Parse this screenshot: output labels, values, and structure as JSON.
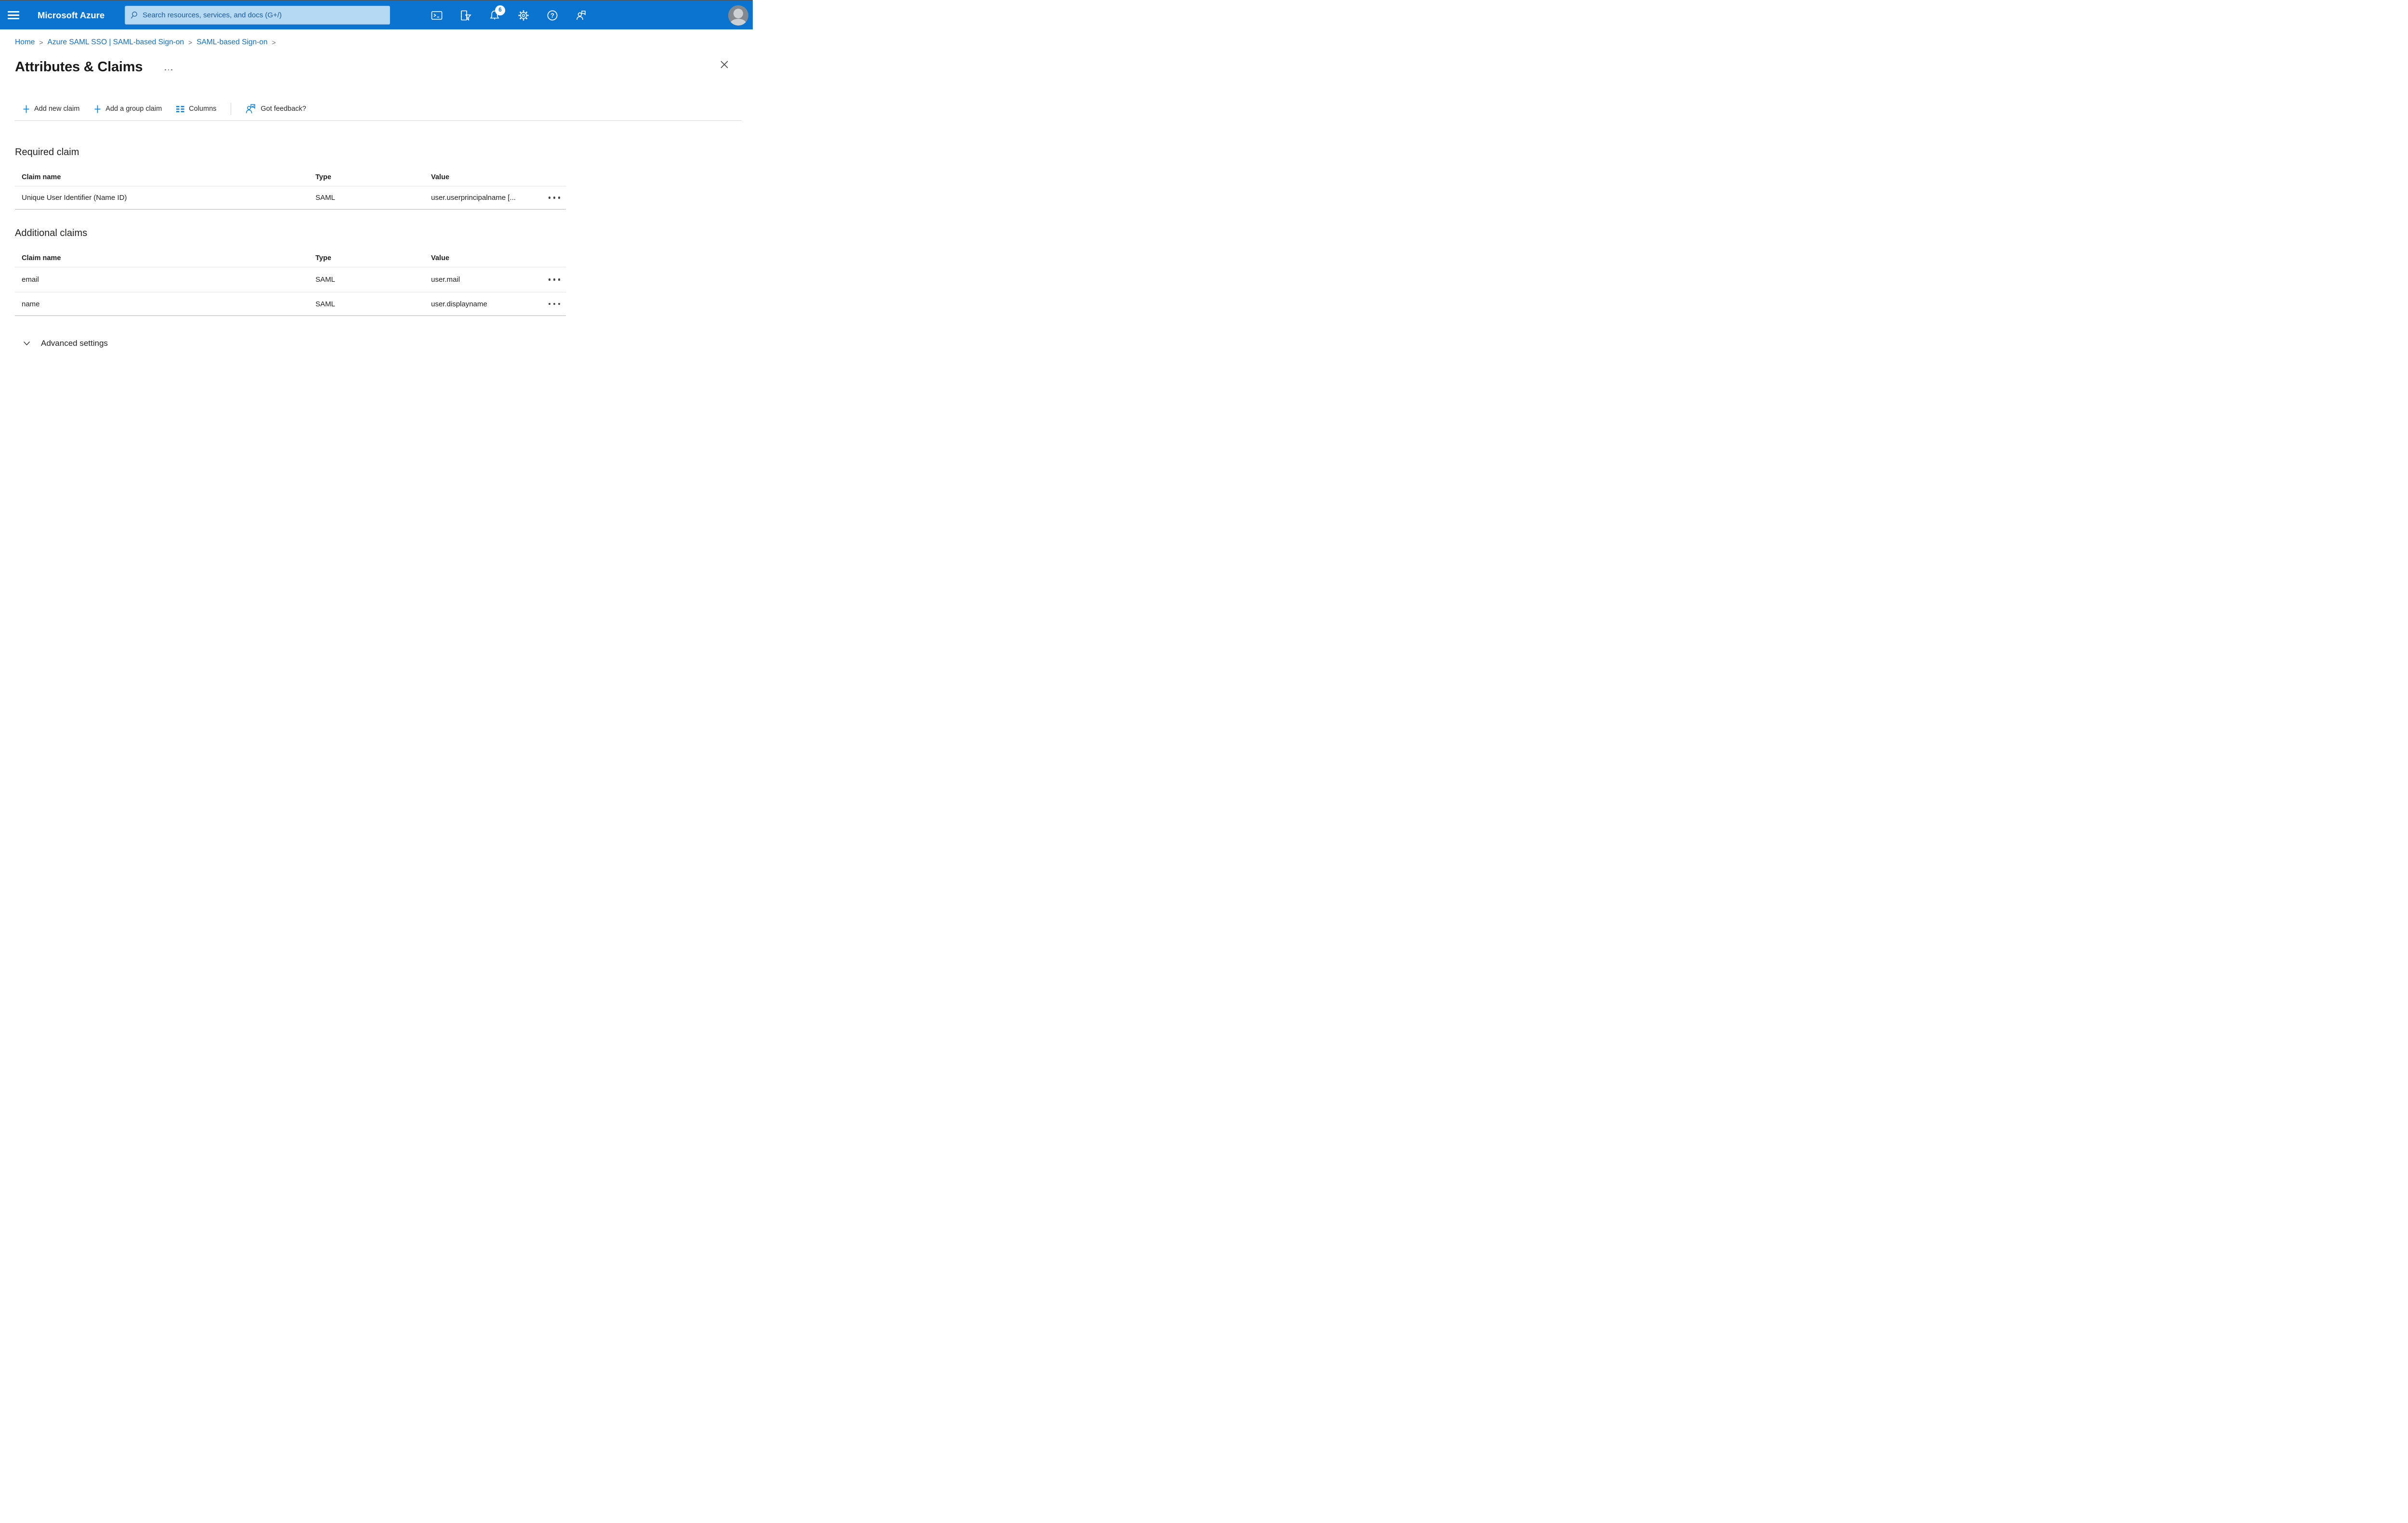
{
  "header": {
    "brand": "Microsoft Azure",
    "search": {
      "placeholder": "Search resources, services, and docs (G+/)"
    },
    "notifications_badge": "6",
    "colors": {
      "bar": "#0b74d1",
      "search_bg": "#b5d9f3",
      "search_text": "#19599b",
      "accent": "#1181d7",
      "link": "#0f6fc9"
    }
  },
  "icons": {
    "hamburger": "≡",
    "search": "magnifier",
    "cloud_shell": ">_",
    "directory_filter": "funnel",
    "notifications": "bell",
    "settings": "gear",
    "help": "?",
    "feedback": "person-with-arrow",
    "avatar": "person-silhouette",
    "plus": "+",
    "columns": "column-bars",
    "ellipsis": "···",
    "row_menu": "•••",
    "chevron_down": "∨",
    "close": "✕",
    "breadcrumb_separator": ">"
  },
  "breadcrumb": {
    "separator": ">",
    "items": [
      "Home",
      "Azure SAML SSO | SAML-based Sign-on",
      "SAML-based Sign-on"
    ]
  },
  "page": {
    "title": "Attributes & Claims"
  },
  "toolbar": {
    "add_new_claim": "Add new claim",
    "add_group_claim": "Add a group claim",
    "columns": "Columns",
    "got_feedback": "Got feedback?"
  },
  "required_section": {
    "heading": "Required claim",
    "columns": {
      "claim_name": "Claim name",
      "type": "Type",
      "value": "Value"
    },
    "rows": [
      {
        "claim_name": "Unique User Identifier (Name ID)",
        "type": "SAML",
        "value": "user.userprincipalname [..."
      }
    ]
  },
  "additional_section": {
    "heading": "Additional claims",
    "columns": {
      "claim_name": "Claim name",
      "type": "Type",
      "value": "Value"
    },
    "rows": [
      {
        "claim_name": "email",
        "type": "SAML",
        "value": "user.mail"
      },
      {
        "claim_name": "name",
        "type": "SAML",
        "value": "user.displayname"
      }
    ]
  },
  "advanced": {
    "label": "Advanced settings"
  }
}
